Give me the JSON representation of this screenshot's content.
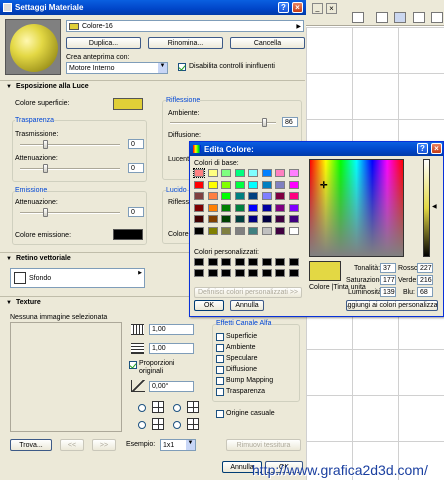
{
  "mat_dialog": {
    "title": "Settaggi Materiale",
    "material_name": "Colore-16",
    "buttons": {
      "duplicate": "Duplica...",
      "rename": "Rinomina...",
      "delete": "Cancella"
    },
    "preview_label": "Crea anteprima con:",
    "preview_engine": "Motore Interno",
    "disable_label": "Disabilita controlli ininfluenti",
    "sections": {
      "light": "Esposizione alla Luce",
      "vector": "Retino vettoriale",
      "texture": "Texture"
    },
    "surface_color_label": "Colore superficie:",
    "surface_color": "#e0cf38",
    "transparency": {
      "title": "Trasparenza",
      "transmission": "Trasmissione:",
      "transmission_val": "0",
      "attenuation": "Attenuazione:",
      "attenuation_val": "0"
    },
    "emission": {
      "title": "Emissione",
      "attenuation": "Attenuazione:",
      "attenuation_val": "0",
      "color_label": "Colore emissione:",
      "color": "#000000"
    },
    "reflection": {
      "title": "Riflessione",
      "ambient": "Ambiente:",
      "ambient_val": "86",
      "diffusion": "Diffusione:",
      "shine": "Lucente"
    },
    "gloss": {
      "title": "Lucido",
      "reflection": "Riflesso",
      "color_r": "Colore r"
    },
    "vector_pattern": "Sfondo",
    "texture": {
      "no_image": "Nessuna immagine selezionata",
      "width": "1,00",
      "height": "1,00",
      "proportions": "Proporzioni originali",
      "angle": "0,00°",
      "alpha_title": "Effetti Canale Alfa",
      "alpha_items": [
        "Superficie",
        "Ambiente",
        "Speculare",
        "Diffusione",
        "Bump Mapping",
        "Trasparenza"
      ],
      "random_origin": "Origine casuale",
      "find": "Trova...",
      "prev": "<<",
      "next": ">>",
      "example_label": "Esempio:",
      "example_val": "1x1",
      "remove": "Rimuovi tessitura"
    },
    "cancel_partial": "Annulla",
    "ok_partial": "OK"
  },
  "color_dialog": {
    "title": "Edita Colore:",
    "basic_label": "Colori di base:",
    "custom_label": "Colori personalizzati:",
    "define_custom": "Definisci colori personalizzati >>",
    "ok": "OK",
    "cancel": "Annulla",
    "color_solid_label": "Colore |Tinta unita",
    "hue_label": "Tonalità:",
    "hue": "37",
    "sat_label": "Saturazione:",
    "sat": "177",
    "lum_label": "Luminosità:",
    "lum": "139",
    "red_label": "Rosso:",
    "red": "227",
    "green_label": "Verde:",
    "green": "216",
    "blue_label": "Blu:",
    "blue": "68",
    "add_custom": "Aggiungi ai colori personalizzati",
    "current_color": "#e3d844",
    "basic_colors": [
      "#ff8080",
      "#ffff80",
      "#80ff80",
      "#00ff80",
      "#80ffff",
      "#0080ff",
      "#ff80c0",
      "#ff80ff",
      "#ff0000",
      "#ffff00",
      "#80ff00",
      "#00ff40",
      "#00ffff",
      "#0080c0",
      "#8080c0",
      "#ff00ff",
      "#804040",
      "#ff8040",
      "#00ff00",
      "#008080",
      "#004080",
      "#8080ff",
      "#800040",
      "#ff0080",
      "#800000",
      "#ff8000",
      "#008000",
      "#008040",
      "#0000ff",
      "#0000a0",
      "#800080",
      "#8000ff",
      "#400000",
      "#804000",
      "#004000",
      "#004040",
      "#000080",
      "#000040",
      "#400040",
      "#400080",
      "#000000",
      "#808000",
      "#808040",
      "#808080",
      "#408080",
      "#c0c0c0",
      "#400040",
      "#ffffff"
    ]
  },
  "watermark": "http://www.grafica2d3d.com/"
}
